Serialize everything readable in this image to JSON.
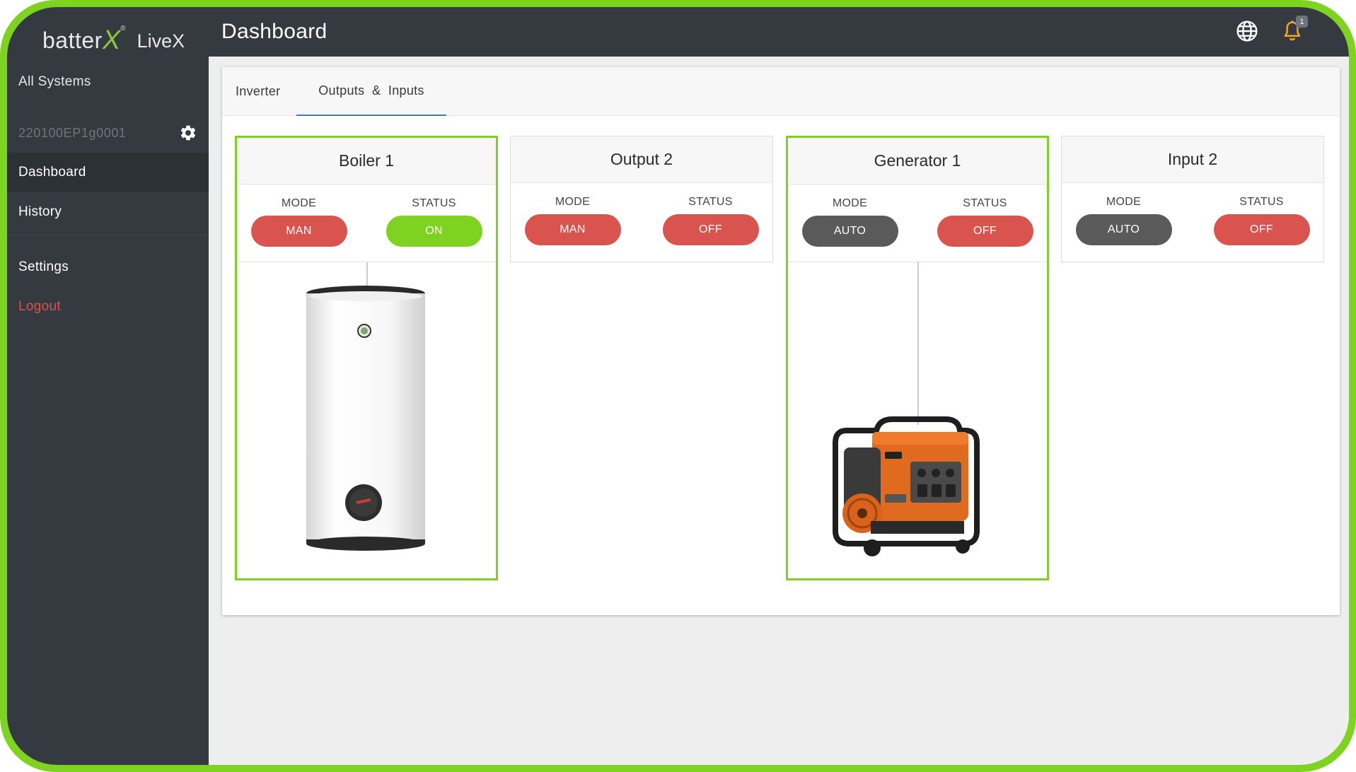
{
  "app": {
    "brand": "batter",
    "brand_x": "X",
    "reg": "®",
    "product": "LiveX"
  },
  "sidebar": {
    "all_systems": "All Systems",
    "device_id": "220100EP1g0001",
    "items": [
      {
        "label": "Dashboard"
      },
      {
        "label": "History"
      },
      {
        "label": "Settings"
      },
      {
        "label": "Logout"
      }
    ]
  },
  "header": {
    "title": "Dashboard",
    "notification_count": "1"
  },
  "tabs": [
    {
      "label": "Inverter"
    },
    {
      "label": "Outputs  &  Inputs"
    }
  ],
  "devices": [
    {
      "name": "Boiler 1",
      "mode_label": "MODE",
      "status_label": "STATUS",
      "mode": "MAN",
      "status": "ON",
      "image": "boiler-image"
    },
    {
      "name": "Output 2",
      "mode_label": "MODE",
      "status_label": "STATUS",
      "mode": "MAN",
      "status": "OFF"
    },
    {
      "name": "Generator 1",
      "mode_label": "MODE",
      "status_label": "STATUS",
      "mode": "AUTO",
      "status": "OFF",
      "image": "generator-image"
    },
    {
      "name": "Input 2",
      "mode_label": "MODE",
      "status_label": "STATUS",
      "mode": "AUTO",
      "status": "OFF"
    }
  ],
  "colors": {
    "accent_green": "#7ed321",
    "danger_red": "#d9534f",
    "neutral_grey": "#5a5a5a",
    "tab_underline": "#3a7bd5",
    "sidebar_bg": "#343a40"
  },
  "icons": [
    "gear-icon",
    "globe-icon",
    "bell-icon"
  ]
}
